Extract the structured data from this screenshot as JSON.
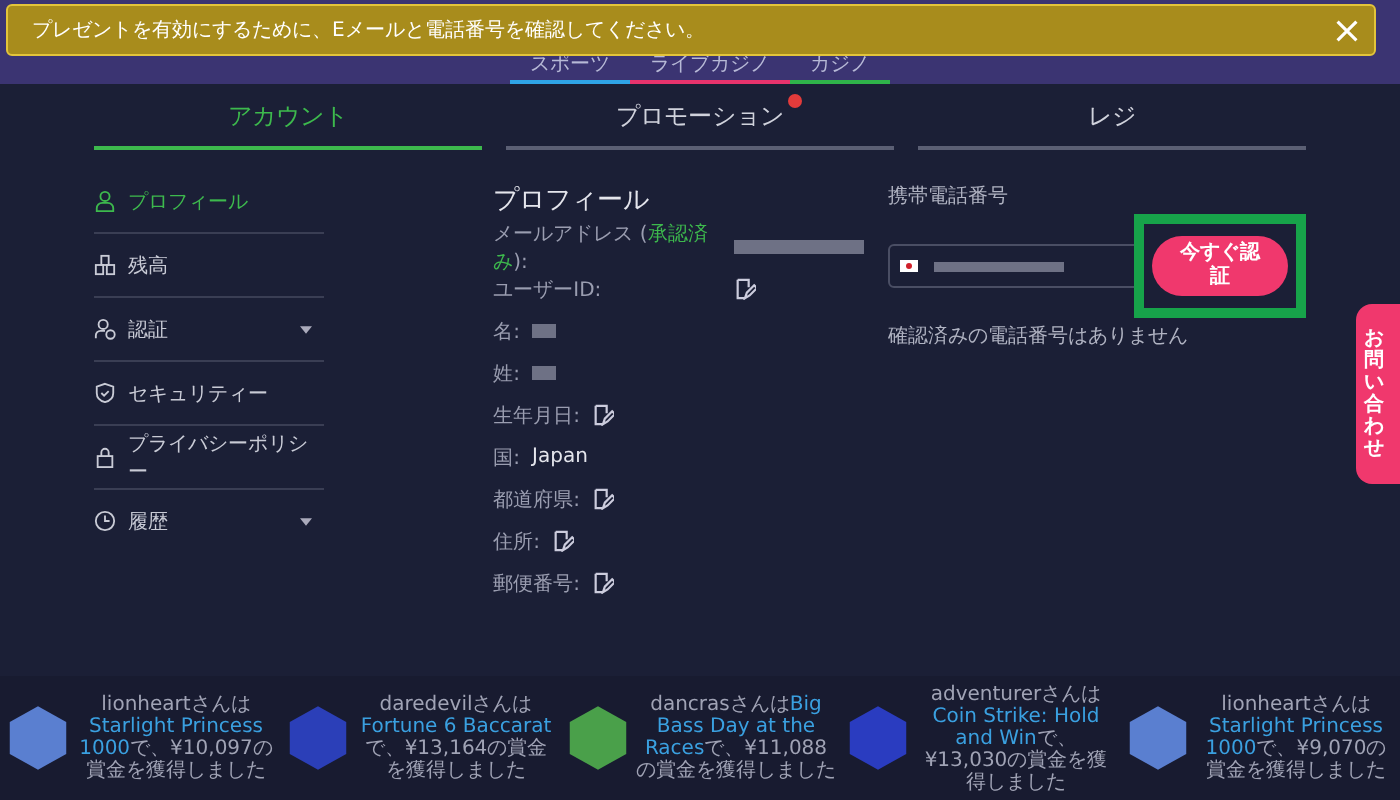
{
  "banner": {
    "message": "プレゼントを有効にするために、Eメールと電話番号を確認してください。"
  },
  "category_tabs": [
    {
      "label": "スポーツ",
      "color": "#2fa4e7"
    },
    {
      "label": "ライブカジノ",
      "color": "#e8336d"
    },
    {
      "label": "カジノ",
      "color": "#2fb34a"
    }
  ],
  "account_tabs": [
    {
      "label": "アカウント",
      "selected": true,
      "notification": false
    },
    {
      "label": "プロモーション",
      "selected": false,
      "notification": true
    },
    {
      "label": "レジ",
      "selected": false,
      "notification": false
    }
  ],
  "sidebar": {
    "items": [
      {
        "label": "プロフィール",
        "selected": true,
        "expandable": false
      },
      {
        "label": "残高",
        "selected": false,
        "expandable": false
      },
      {
        "label": "認証",
        "selected": false,
        "expandable": true
      },
      {
        "label": "セキュリティー",
        "selected": false,
        "expandable": false
      },
      {
        "label": "プライバシーポリシー",
        "selected": false,
        "expandable": false
      },
      {
        "label": "履歴",
        "selected": false,
        "expandable": true
      }
    ]
  },
  "profile": {
    "title": "プロフィール",
    "fields": [
      {
        "kind": "email",
        "label": "メールアドレス (",
        "status": "承認済み",
        "label_end": "):"
      },
      {
        "kind": "edit",
        "label": "ユーザーID:"
      },
      {
        "kind": "blurred",
        "label": "名:"
      },
      {
        "kind": "blurred",
        "label": "姓:"
      },
      {
        "kind": "edit",
        "label": "生年月日:"
      },
      {
        "kind": "text",
        "label": "国:",
        "value": "Japan"
      },
      {
        "kind": "edit",
        "label": "都道府県:"
      },
      {
        "kind": "edit",
        "label": "住所:"
      },
      {
        "kind": "edit",
        "label": "郵便番号:"
      }
    ]
  },
  "phone": {
    "label": "携帯電話番号",
    "button": "今すぐ認証",
    "note": "確認済みの電話番号はありません"
  },
  "support_tab": {
    "label": "お問い合わせ"
  },
  "winners": [
    {
      "user": "lionheartさんは",
      "game": "Starlight Princess 1000",
      "prize": "で、¥10,097の賞金を獲得しました",
      "color": "#5a7fd0"
    },
    {
      "user": "daredevilさんは",
      "game": "Fortune 6 Baccarat",
      "prize": "で、¥13,164の賞金を獲得しました",
      "color": "#2b3fb8"
    },
    {
      "user": "dancrasさんは",
      "game": "Big Bass Day at the Races",
      "prize": "で、¥11,088の賞金を獲得しました",
      "color": "#4aa04a"
    },
    {
      "user": "adventurerさんは",
      "game": "Coin Strike: Hold and Win",
      "prize": "で、¥13,030の賞金を獲得しました",
      "color": "#2a3cc0"
    },
    {
      "user": "lionheartさんは",
      "game": "Starlight Princess 1000",
      "prize": "で、¥9,070の賞金を獲得しました",
      "color": "#5a7fd0"
    }
  ]
}
